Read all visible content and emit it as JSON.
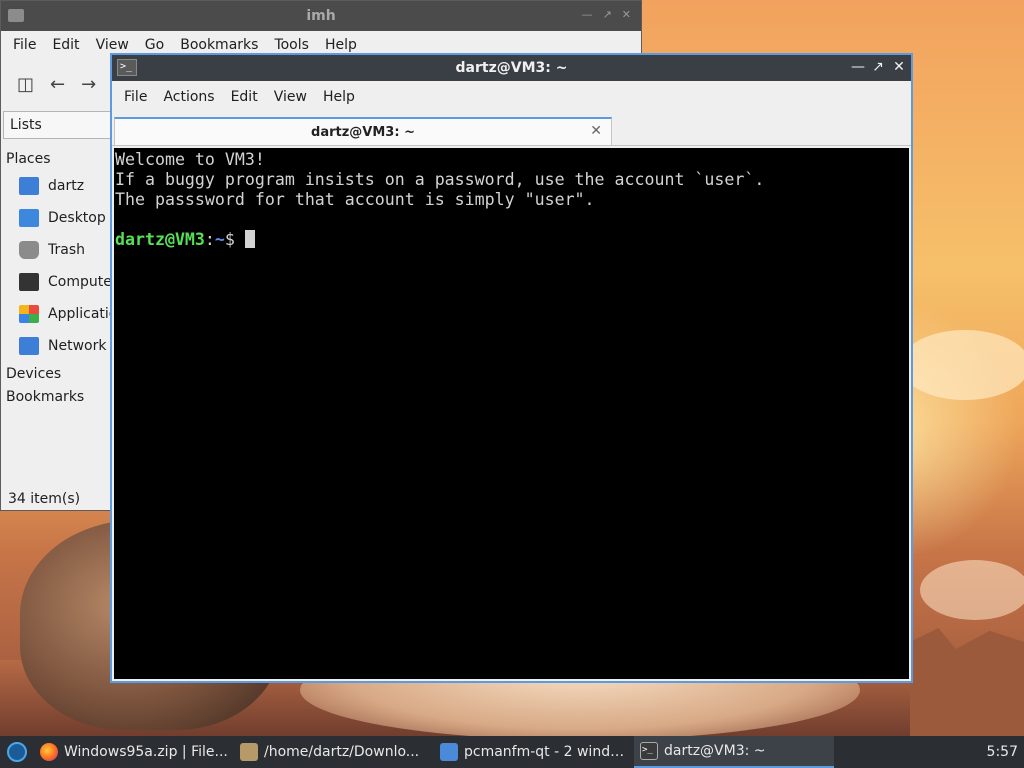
{
  "file_manager": {
    "title": "imh",
    "menu": [
      "File",
      "Edit",
      "View",
      "Go",
      "Bookmarks",
      "Tools",
      "Help"
    ],
    "side_panel_mode": "Lists",
    "places_heading": "Places",
    "places": [
      {
        "label": "dartz",
        "icon": "home-folder-icon"
      },
      {
        "label": "Desktop",
        "icon": "desktop-icon"
      },
      {
        "label": "Trash",
        "icon": "trash-icon"
      },
      {
        "label": "Compute",
        "icon": "computer-icon"
      },
      {
        "label": "Applicatio",
        "icon": "applications-icon"
      },
      {
        "label": "Network",
        "icon": "network-icon"
      }
    ],
    "devices_heading": "Devices",
    "bookmarks_heading": "Bookmarks",
    "status": "34 item(s)"
  },
  "terminal": {
    "title": "dartz@VM3: ~",
    "menu": [
      "File",
      "Actions",
      "Edit",
      "View",
      "Help"
    ],
    "tab_label": "dartz@VM3: ~",
    "lines": [
      "Welcome to VM3!",
      "If a buggy program insists on a password, use the account `user`.",
      "The passsword for that account is simply \"user\".",
      ""
    ],
    "prompt": {
      "user_host": "dartz@VM3",
      "separator": ":",
      "path": "~",
      "symbol": "$"
    }
  },
  "taskbar": {
    "items": [
      {
        "label": "Windows95a.zip | File...",
        "icon": "firefox-icon",
        "active": false
      },
      {
        "label": "/home/dartz/Downlo...",
        "icon": "archive-icon",
        "active": false
      },
      {
        "label": "pcmanfm-qt - 2 windo...",
        "icon": "folder-icon",
        "active": false
      },
      {
        "label": "dartz@VM3: ~",
        "icon": "terminal-icon",
        "active": true
      }
    ],
    "clock": "5:57"
  },
  "colors": {
    "terminal_bg": "#000000",
    "prompt_user": "#55e055",
    "prompt_path": "#5c8ef0",
    "window_accent": "#5d9ae0"
  }
}
